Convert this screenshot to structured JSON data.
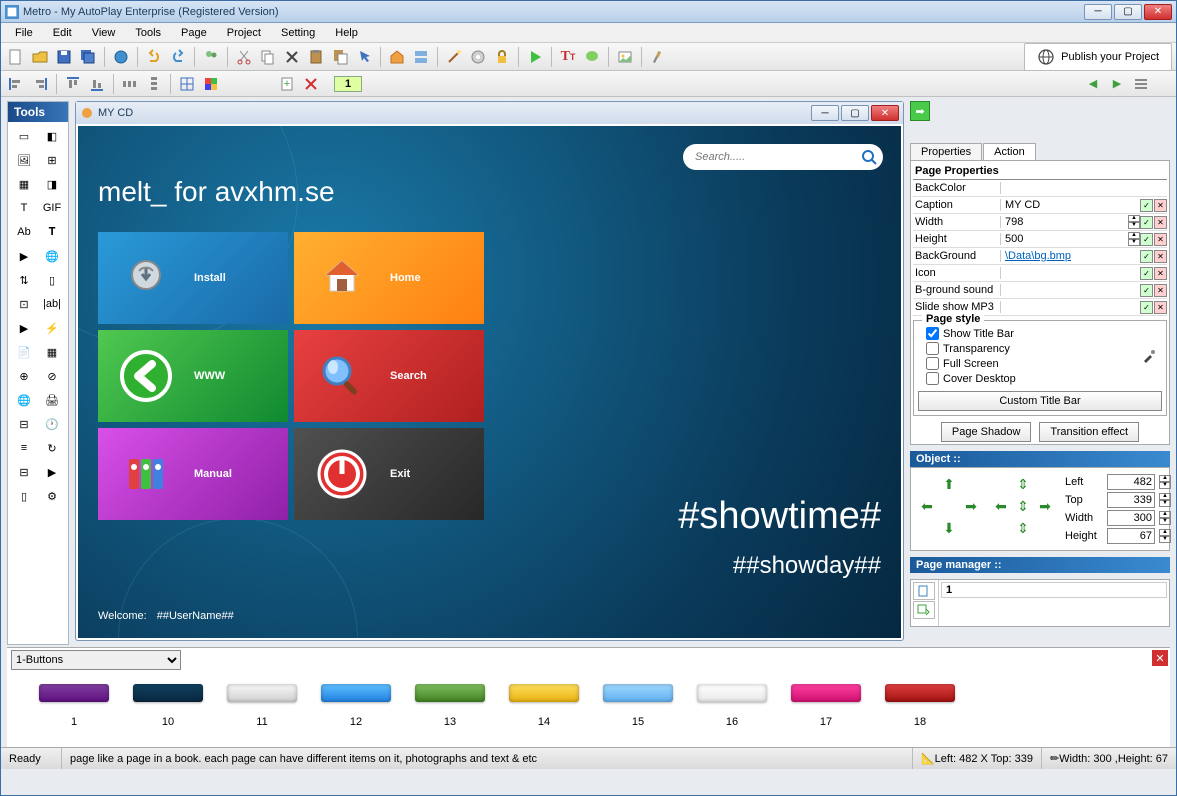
{
  "window": {
    "title": "Metro - My AutoPlay Enterprise (Registered Version)"
  },
  "menu": [
    "File",
    "Edit",
    "View",
    "Tools",
    "Page",
    "Project",
    "Setting",
    "Help"
  ],
  "publish": "Publish your Project",
  "page_indicator": "1",
  "tools_title": "Tools",
  "inner_window": {
    "title": "MY CD"
  },
  "canvas": {
    "brand": "melt_ for avxhm.se",
    "search_placeholder": "Search.....",
    "tiles": [
      {
        "label": "Install",
        "cls": "t-blue"
      },
      {
        "label": "Home",
        "cls": "t-orange"
      },
      {
        "label": "WWW",
        "cls": "t-green"
      },
      {
        "label": "Search",
        "cls": "t-red"
      },
      {
        "label": "Manual",
        "cls": "t-purple"
      },
      {
        "label": "Exit",
        "cls": "t-dark"
      }
    ],
    "showtime": "#showtime#",
    "showday": "##showday##",
    "welcome_label": "Welcome:",
    "welcome_user": "##UserName##"
  },
  "props": {
    "tab_properties": "Properties",
    "tab_action": "Action",
    "header": "Page Properties",
    "rows": [
      {
        "label": "BackColor",
        "val": ""
      },
      {
        "label": "Caption",
        "val": "MY CD"
      },
      {
        "label": "Width",
        "val": "798"
      },
      {
        "label": "Height",
        "val": "500"
      },
      {
        "label": "BackGround",
        "val": "\\Data\\bg.bmp",
        "link": true
      },
      {
        "label": "Icon",
        "val": ""
      },
      {
        "label": "B-ground sound",
        "val": ""
      },
      {
        "label": "Slide show MP3",
        "val": ""
      }
    ],
    "style_title": "Page style",
    "checks": [
      {
        "label": "Show Title Bar",
        "checked": true
      },
      {
        "label": "Transparency",
        "checked": false
      },
      {
        "label": "Full Screen",
        "checked": false
      },
      {
        "label": "Cover Desktop",
        "checked": false
      }
    ],
    "custom_titlebar": "Custom Title Bar",
    "page_shadow": "Page Shadow",
    "transition": "Transition effect"
  },
  "object": {
    "header": "Object ::",
    "left_lbl": "Left",
    "left": "482",
    "top_lbl": "Top",
    "top": "339",
    "width_lbl": "Width",
    "width": "300",
    "height_lbl": "Height",
    "height": "67"
  },
  "page_manager": {
    "header": "Page manager ::",
    "item": "1"
  },
  "gallery": {
    "selector": "1-Buttons",
    "items": [
      {
        "n": "1",
        "c": "linear-gradient(#8040a0,#601080)"
      },
      {
        "n": "10",
        "c": "linear-gradient(#104060,#082840)"
      },
      {
        "n": "11",
        "c": "linear-gradient(#f8f8f8,#d0d0d0)"
      },
      {
        "n": "12",
        "c": "linear-gradient(#60c0ff,#2080e0)"
      },
      {
        "n": "13",
        "c": "linear-gradient(#80c060,#408020)"
      },
      {
        "n": "14",
        "c": "linear-gradient(#ffe060,#e8b010)"
      },
      {
        "n": "15",
        "c": "linear-gradient(#a0d8ff,#60b0f0)"
      },
      {
        "n": "16",
        "c": "linear-gradient(#ffffff,#e8e8e8)"
      },
      {
        "n": "17",
        "c": "linear-gradient(#ff40a0,#d01070)"
      },
      {
        "n": "18",
        "c": "linear-gradient(#e04040,#a01010)"
      }
    ]
  },
  "status": {
    "ready": "Ready",
    "hint": "page like a page in a book. each page can have different items on it, photographs and text & etc",
    "pos": "Left: 482 X Top: 339",
    "size": "Width: 300 ,Height: 67"
  }
}
